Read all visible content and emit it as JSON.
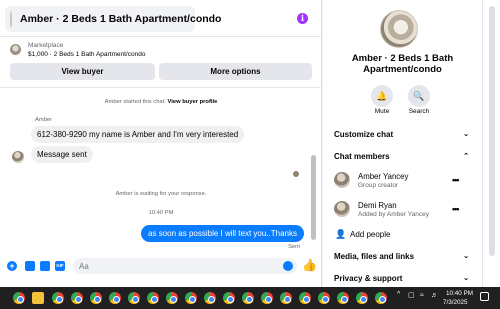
{
  "chat": {
    "title": "Amber · 2 Beds 1 Bath Apartment/condo",
    "info_icon": "info-icon"
  },
  "listing": {
    "label": "Marketplace",
    "price_title": "$1,000 · 2 Beds 1 Bath Apartment/condo",
    "view_buyer": "View buyer",
    "more_options": "More options"
  },
  "messages": {
    "started_text": "Amber started this chat.",
    "view_profile": "View buyer profile",
    "sender": "Amber",
    "incoming": [
      "612-380-9290 my name is Amber and I'm very interested",
      "Message sent"
    ],
    "waiting": "Amber is waiting for your response.",
    "time": "10:40 PM",
    "outgoing": "as soon as possible I will text you..Thanks",
    "status": "Sent"
  },
  "composer": {
    "placeholder": "Aa"
  },
  "sidebar": {
    "title": "Amber · 2 Beds 1 Bath Apartment/condo",
    "actions": [
      {
        "label": "Mute",
        "icon": "bell-icon"
      },
      {
        "label": "Search",
        "icon": "search-icon"
      }
    ],
    "customize": "Customize chat",
    "members_header": "Chat members",
    "members": [
      {
        "name": "Amber Yancey",
        "sub": "Group creator"
      },
      {
        "name": "Demi Ryan",
        "sub": "Added by Amber Yancey"
      }
    ],
    "add_people": "Add people",
    "media": "Media, files and links",
    "privacy": "Privacy & support"
  },
  "taskbar": {
    "time": "10:40 PM",
    "date": "7/3/2025"
  },
  "colors": {
    "accent": "#0a7cff",
    "info": "#a033ff",
    "taskbar": "#202020"
  }
}
